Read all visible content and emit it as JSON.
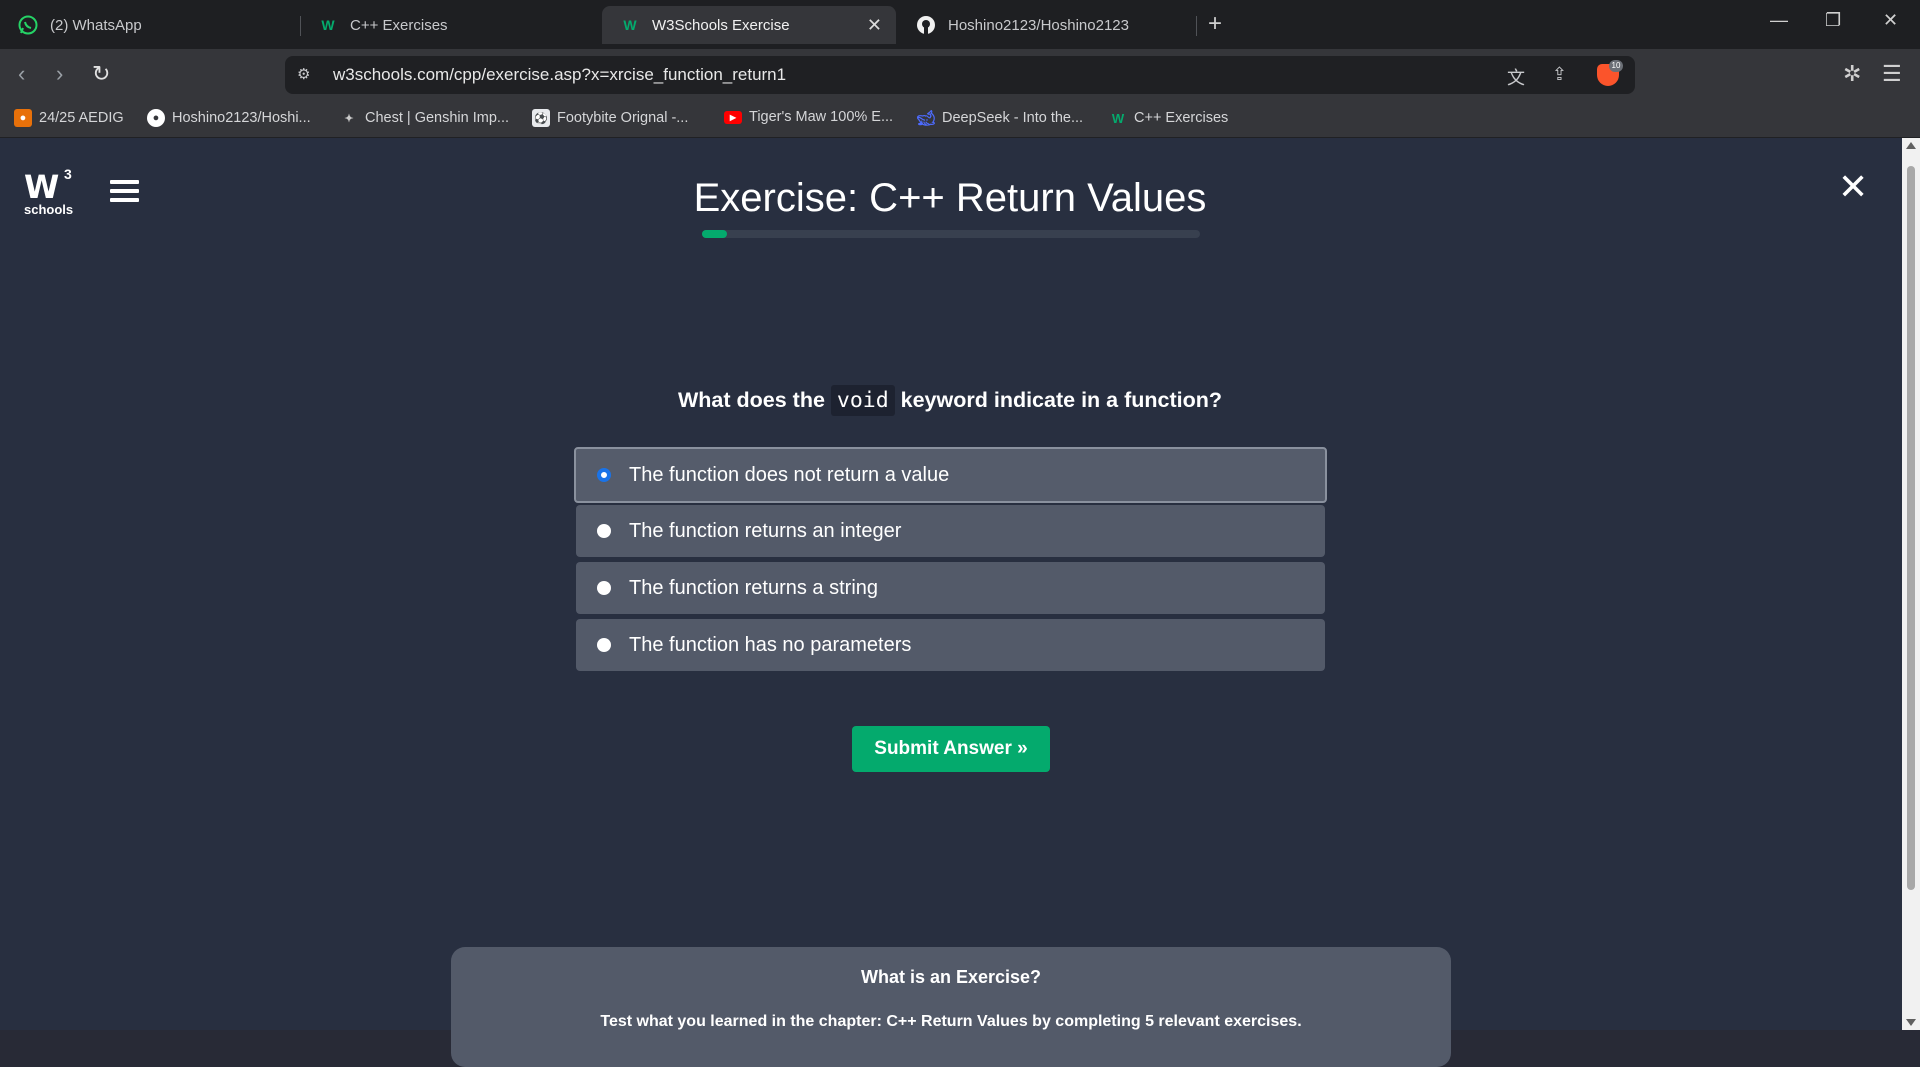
{
  "tabs": [
    {
      "label": "(2) WhatsApp",
      "icon": "whatsapp-icon"
    },
    {
      "label": "C++ Exercises",
      "icon": "w3schools-icon"
    },
    {
      "label": "W3Schools Exercise",
      "icon": "w3schools-icon",
      "active": true
    },
    {
      "label": "Hoshino2123/Hoshino2123",
      "icon": "github-icon"
    }
  ],
  "address": {
    "url": "w3schools.com/cpp/exercise.asp?x=xrcise_function_return1",
    "brave_badge": "10"
  },
  "bookmarks": [
    {
      "label": "24/25 AEDIG",
      "icon": "user-icon",
      "color": "#e8710a"
    },
    {
      "label": "Hoshino2123/Hoshi...",
      "icon": "github-icon",
      "color": "#ffffff"
    },
    {
      "label": "Chest | Genshin Imp...",
      "icon": "genshin-icon",
      "color": "#c9c9c9"
    },
    {
      "label": "Footybite Orignal -...",
      "icon": "football-icon",
      "color": "#e8eaed"
    },
    {
      "label": "Tiger's Maw 100% E...",
      "icon": "youtube-icon",
      "color": "#ff0000"
    },
    {
      "label": "DeepSeek - Into the...",
      "icon": "deepseek-icon",
      "color": "#4d6bfe"
    },
    {
      "label": "C++ Exercises",
      "icon": "w3schools-icon",
      "color": "#04aa6d"
    }
  ],
  "page": {
    "logo_text": "W",
    "logo_sup": "3",
    "logo_sub": "schools",
    "title": "Exercise: C++ Return Values",
    "progress_fraction": 0.05,
    "question_before": "What does the ",
    "question_code": "void",
    "question_after": " keyword indicate in a function?",
    "options": [
      "The function does not return a value",
      "The function returns an integer",
      "The function returns a string",
      "The function has no parameters"
    ],
    "selected_option_index": 0,
    "submit_label": "Submit Answer »",
    "info_title": "What is an Exercise?",
    "info_text": "Test what you learned in the chapter: C++ Return Values by completing 5 relevant exercises."
  },
  "colors": {
    "accent": "#04aa6d",
    "page_bg": "#282f40",
    "option_bg": "#535a69"
  }
}
